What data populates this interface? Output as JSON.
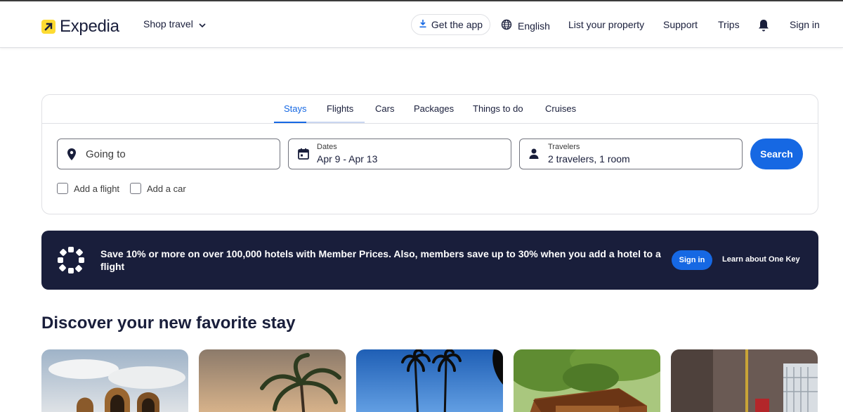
{
  "header": {
    "logo_text": "Expedia",
    "shop_travel": "Shop travel",
    "get_app": "Get the app",
    "language": "English",
    "list_property": "List your property",
    "support": "Support",
    "trips": "Trips",
    "sign_in": "Sign in"
  },
  "search": {
    "tabs": [
      {
        "label": "Stays",
        "active": true
      },
      {
        "label": "Flights",
        "active": false
      },
      {
        "label": "Cars",
        "active": false
      },
      {
        "label": "Packages",
        "active": false
      },
      {
        "label": "Things to do",
        "active": false
      },
      {
        "label": "Cruises",
        "active": false
      }
    ],
    "destination_placeholder": "Going to",
    "dates_label": "Dates",
    "dates_value": "Apr 9 - Apr 13",
    "travelers_label": "Travelers",
    "travelers_value": "2 travelers, 1 room",
    "search_button": "Search",
    "add_flight": "Add a flight",
    "add_car": "Add a car"
  },
  "banner": {
    "text": "Save 10% or more on over 100,000 hotels with Member Prices. Also, members save up to 30% when you add a hotel to a flight",
    "sign_in": "Sign in",
    "learn": "Learn about One Key"
  },
  "discover": {
    "title": "Discover your new favorite stay"
  },
  "colors": {
    "brand_blue": "#1668e3",
    "navy": "#191e3b",
    "logo_yellow": "#fddb32"
  }
}
